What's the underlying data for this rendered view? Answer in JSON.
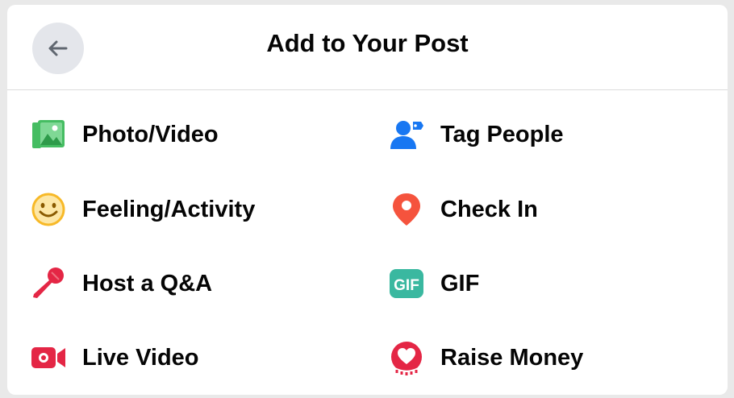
{
  "header": {
    "title": "Add to Your Post",
    "back_icon": "arrow-left-icon"
  },
  "options": [
    {
      "label": "Photo/Video",
      "icon": "photo-video-icon",
      "color": "#45bd62"
    },
    {
      "label": "Tag People",
      "icon": "tag-people-icon",
      "color": "#1877f2"
    },
    {
      "label": "Feeling/Activity",
      "icon": "feeling-smiley-icon",
      "color": "#f7b928"
    },
    {
      "label": "Check In",
      "icon": "location-pin-icon",
      "color": "#f5533d"
    },
    {
      "label": "Host a Q&A",
      "icon": "microphone-icon",
      "color": "#e42645"
    },
    {
      "label": "GIF",
      "icon": "gif-icon",
      "color": "#3ab8a0"
    },
    {
      "label": "Live Video",
      "icon": "live-video-camera-icon",
      "color": "#e42645"
    },
    {
      "label": "Raise Money",
      "icon": "fundraiser-heart-icon",
      "color": "#e42645"
    }
  ]
}
